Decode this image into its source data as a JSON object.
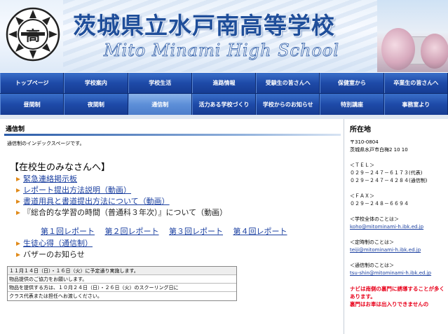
{
  "header": {
    "title": "茨城県立水戸南高等学校",
    "subtitle": "Mito Minami High School",
    "crest_text": "高",
    "colors": {
      "title": "#1f4e9a",
      "nav": "#1e4aa8",
      "nav_active": "#5d8fd8",
      "link": "#1a3fa0",
      "warning": "#e8001a"
    }
  },
  "nav": {
    "row1": [
      "トップページ",
      "学校案内",
      "学校生活",
      "進路情報",
      "受験生の皆さんへ",
      "保健室から",
      "卒業生の皆さんへ"
    ],
    "row2": [
      "昼間制",
      "夜間制",
      "通信制",
      "活力ある学校づくり",
      "学校からのお知らせ",
      "特別講座",
      "事務室より"
    ],
    "active": "通信制"
  },
  "main": {
    "section_title": "通信制",
    "intro": "通信制のインデックスページです。",
    "heading": "【在校生のみなさんへ】",
    "links": [
      {
        "label": "緊急連絡掲示板"
      },
      {
        "label": "レポート提出方法説明（動画）"
      },
      {
        "label": "書道用具と書道提出方法について（動画）"
      },
      {
        "label": "『総合的な学習の時間（普通科３年次）』について（動画）"
      }
    ],
    "reports": [
      "第１回レポート",
      "第２回レポート",
      "第３回レポート",
      "第４回レポート"
    ],
    "links2": [
      {
        "label": "生徒心得（通信制）"
      },
      {
        "label": "バザーのお知らせ"
      }
    ],
    "notice": [
      "１１月１４日（日）・１６日（火）に予定通り実施します。",
      "物品提供のご協力をお願いします。",
      "物品を提供する方は、１０月２４日（日）・２６日（火）のスクーリング日に",
      "クラス代表または担任へお渡しください。"
    ]
  },
  "sidebar": {
    "title": "所在地",
    "postal": "〒310-0804",
    "address": "茨城県水戸市白梅2 10 10",
    "tel_label": "＜ＴＥＬ＞",
    "tel1": "０２９－２４７－６１７３(代表)",
    "tel2": "０２９－２４７－４２８４(通信制)",
    "fax_label": "＜ＦＡＸ＞",
    "fax": "０２９－２４８－６６９４",
    "contact_all_label": "＜学校全体のことは＞",
    "contact_all_mail": "koho@mitominami-h.ibk.ed.jp",
    "contact_teiji_label": "＜定時制のことは＞",
    "contact_teiji_mail": "teiji@mitominami-h.ibk.ed.jp",
    "contact_tsushin_label": "＜通信制のことは＞",
    "contact_tsushin_mail": "tsu-shin@mitominami-h.ibk.ed.jp",
    "warning1": "ナビは南側の裏門に誘導することが多くあります。",
    "warning2": "裏門はお車は出入りできませんの"
  }
}
